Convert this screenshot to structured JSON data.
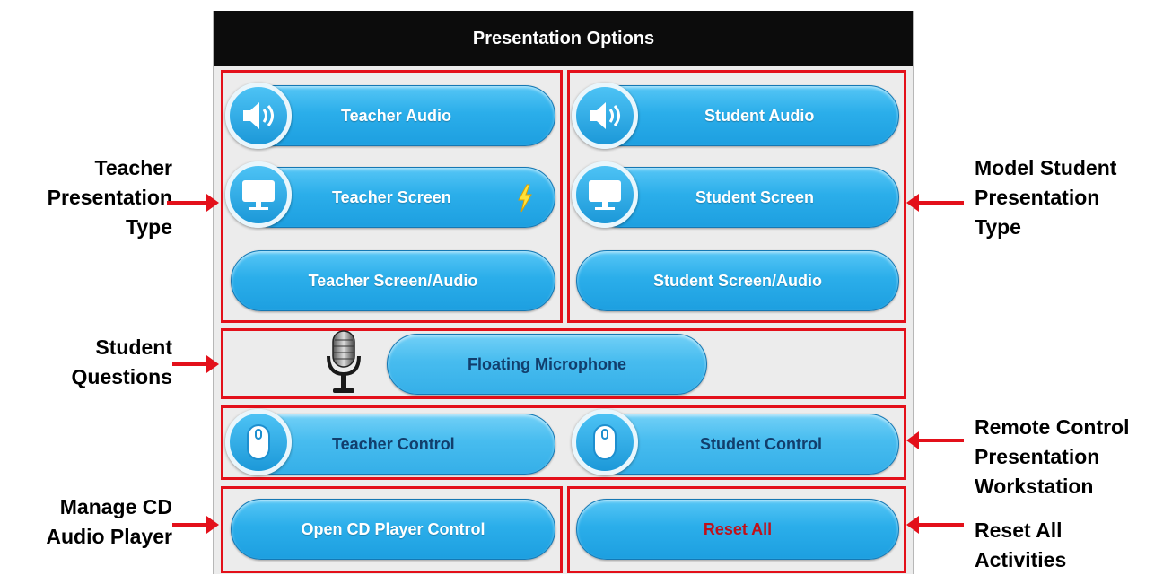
{
  "panel": {
    "title": "Presentation Options",
    "teacher_audio": "Teacher Audio",
    "teacher_screen": "Teacher Screen",
    "teacher_screen_audio": "Teacher Screen/Audio",
    "student_audio": "Student Audio",
    "student_screen": "Student Screen",
    "student_screen_audio": "Student Screen/Audio",
    "floating_microphone": "Floating Microphone",
    "teacher_control": "Teacher Control",
    "student_control": "Student Control",
    "open_cd": "Open CD Player Control",
    "reset_all": "Reset All"
  },
  "annotations": {
    "teacher_type": [
      "Teacher",
      "Presentation",
      "Type"
    ],
    "student_questions": [
      "Student",
      "Questions"
    ],
    "manage_cd": [
      "Manage CD",
      "Audio Player"
    ],
    "model_student": [
      "Model Student",
      "Presentation",
      "Type"
    ],
    "remote_control": [
      "Remote Control",
      "Presentation",
      "Workstation"
    ],
    "reset_activities": [
      "Reset All",
      "Activities"
    ]
  },
  "colors": {
    "highlight": "#e3101a",
    "button": "#2baeea",
    "header": "#0c0c0c",
    "reset_text": "#c0101a"
  },
  "icons": [
    "speaker-icon",
    "monitor-icon",
    "lightning-icon",
    "microphone-icon",
    "mouse-icon"
  ]
}
